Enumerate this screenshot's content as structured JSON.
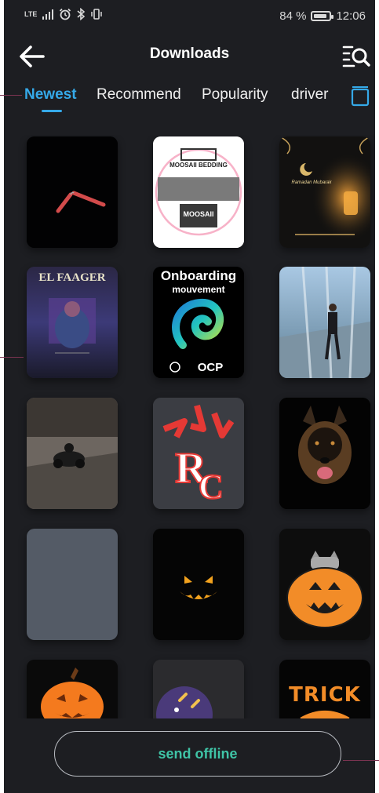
{
  "status_bar": {
    "network": "LTE",
    "battery_percent": "84 %",
    "battery_level": 0.84,
    "time": "12:06"
  },
  "header": {
    "title": "Downloads"
  },
  "tabs": [
    {
      "label": "Newest",
      "active": true
    },
    {
      "label": "Recommend",
      "active": false
    },
    {
      "label": "Popularity",
      "active": false
    },
    {
      "label": "driver",
      "active": false
    }
  ],
  "tiles_text": {
    "moosaii_title": "MOOSAII BEDDING",
    "moosaii_footer": "MOOSAII",
    "elfaager": "EL FAAGER",
    "onboarding_line1": "Onboarding",
    "onboarding_line2": "mouvement",
    "ocp": "OCP",
    "ramadan_text": "Ramadan Mubarak",
    "trick": "TRICK"
  },
  "bottom": {
    "send_offline_label": "send offline"
  },
  "colors": {
    "accent": "#35a9e8",
    "send_offline": "#3fc4a6",
    "background": "#1d1e22"
  }
}
